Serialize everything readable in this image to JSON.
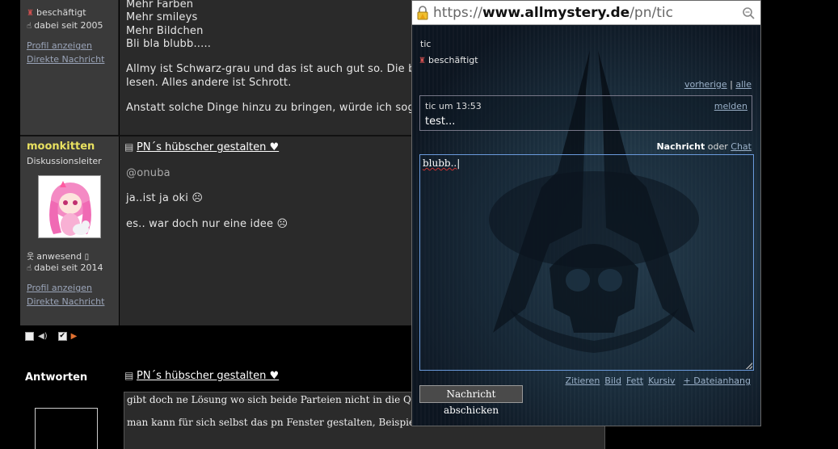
{
  "post1": {
    "status": "beschäftigt",
    "member_since": "dabei seit 2005",
    "profile_link": "Profil anzeigen",
    "message_link": "Direkte Nachricht",
    "lines": [
      "Mehr Farben",
      "Mehr smileys",
      "Mehr Bildchen",
      "Bli bla blubb.....",
      "Allmy ist Schwarz-grau und das ist auch gut so. Die b",
      "lesen. Alles andere ist Schrott.",
      "Anstatt solche Dinge hinzu zu bringen, würde ich soga"
    ]
  },
  "post2": {
    "username": "moonkitten",
    "role": "Diskussionsleiter",
    "status": "anwesend",
    "member_since": "dabei seit 2014",
    "profile_link": "Profil anzeigen",
    "message_link": "Direkte Nachricht",
    "topic": "PN´s hübscher gestalten ♥",
    "lines": [
      "@onuba",
      "ja..ist ja oki ☹",
      "es.. war doch nur eine idee ☹"
    ]
  },
  "reply": {
    "label": "Antworten",
    "topic": "PN´s hübscher gestalten ♥",
    "lines": [
      "gibt doch ne Lösung wo sich beide Parteien nicht in die Quäre komr",
      "man kann für sich selbst das pn Fenster gestalten, Beispiel:"
    ]
  },
  "popup": {
    "url_scheme": "https://",
    "url_domain": "www.allmystery.de",
    "url_path": "/pn/tic",
    "partner_name": "tic",
    "partner_status": "beschäftigt",
    "nav_previous": "vorherige",
    "nav_sep": "|",
    "nav_all": "alle",
    "message_meta": "tic um 13:53",
    "message_report": "melden",
    "message_body": "test...",
    "mode_message": "Nachricht",
    "mode_or": "oder",
    "mode_chat": "Chat",
    "textarea_value": "blubb..",
    "format_buttons": [
      "Zitieren",
      "Bild",
      "Fett",
      "Kursiv",
      "+ Dateianhang"
    ],
    "send_label": "Nachricht abschicken"
  }
}
